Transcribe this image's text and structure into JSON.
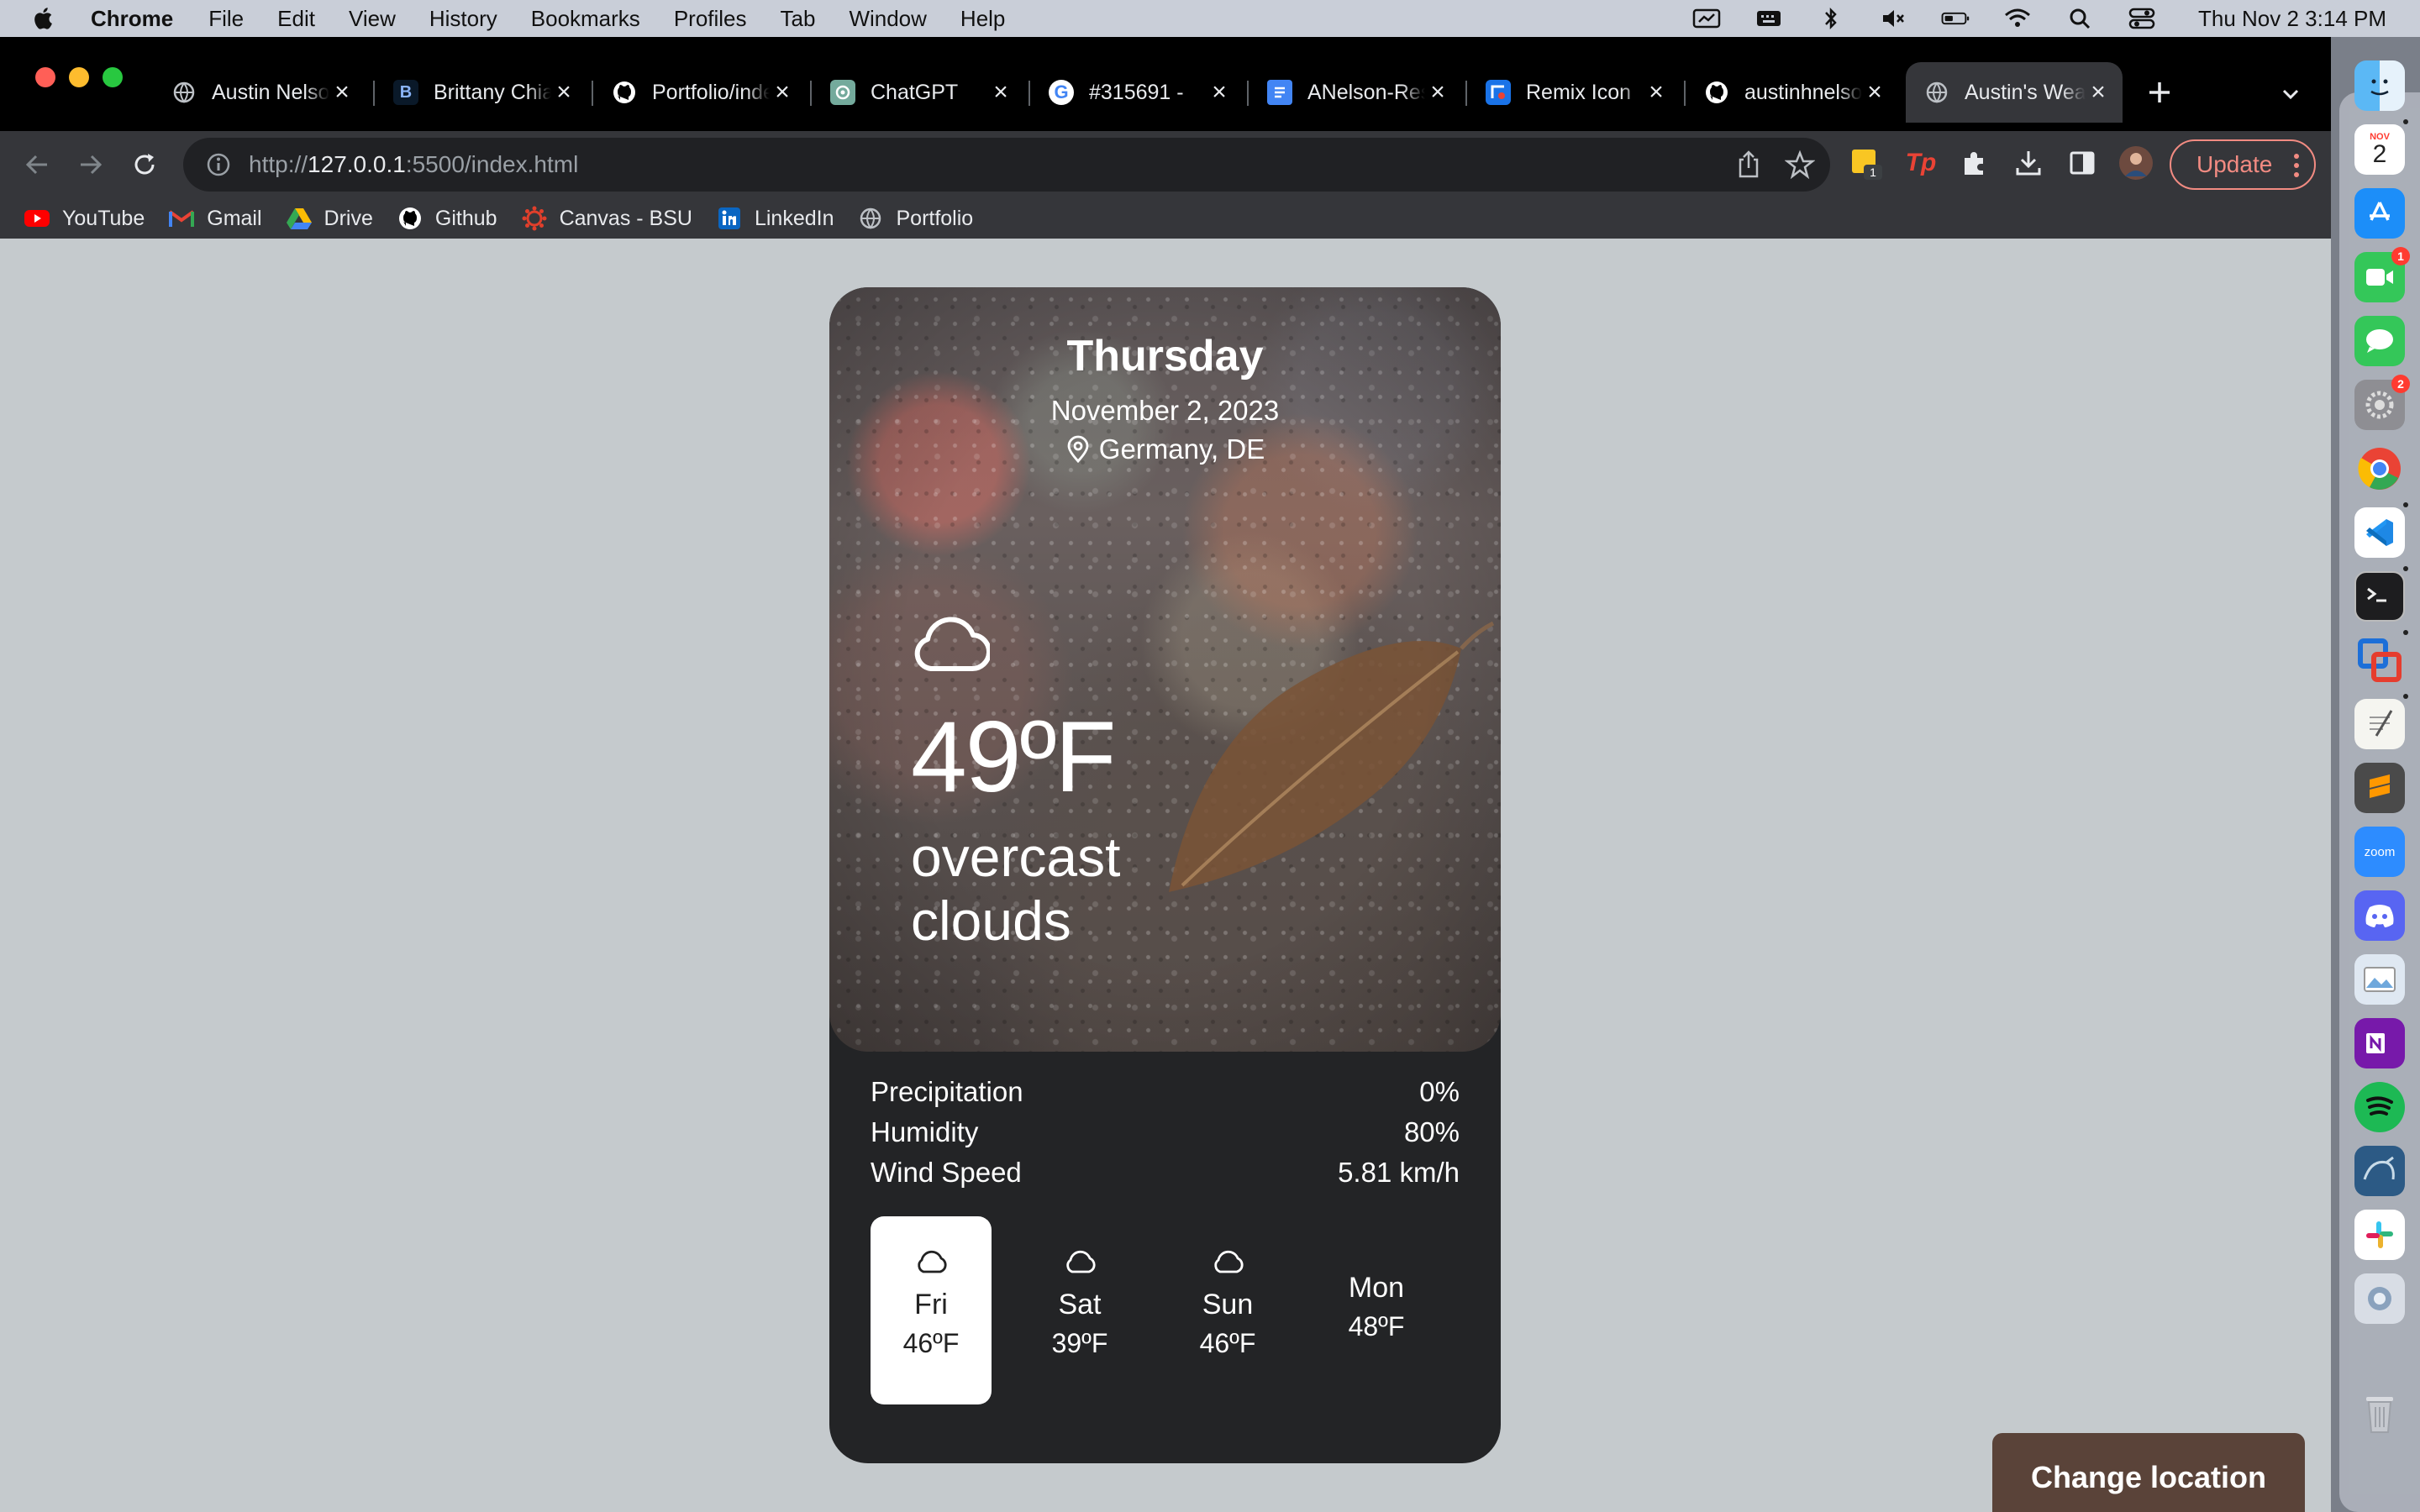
{
  "menubar": {
    "app_name": "Chrome",
    "menus": [
      "File",
      "Edit",
      "View",
      "History",
      "Bookmarks",
      "Profiles",
      "Tab",
      "Window",
      "Help"
    ],
    "clock": "Thu Nov 2  3:14 PM"
  },
  "browser": {
    "tabs": [
      {
        "label": "Austin Nelson",
        "icon": "globe-icon"
      },
      {
        "label": "Brittany Chiang",
        "icon": "b-logo-icon"
      },
      {
        "label": "Portfolio/index",
        "icon": "github-icon"
      },
      {
        "label": "ChatGPT",
        "icon": "chatgpt-icon"
      },
      {
        "label": "#315691 - ",
        "icon": "google-icon"
      },
      {
        "label": "ANelson-Resume",
        "icon": "docs-icon"
      },
      {
        "label": "Remix Icon",
        "icon": "remix-icon"
      },
      {
        "label": "austinhnelson",
        "icon": "github-icon"
      },
      {
        "label": "Austin's Weather",
        "icon": "globe-icon",
        "active": true
      }
    ],
    "url_prefix": "http://",
    "url_host": "127.0.0.1",
    "url_rest": ":5500/index.html",
    "update_label": "Update",
    "extension_badge": "1",
    "bookmarks": [
      {
        "label": "YouTube",
        "icon": "youtube-icon"
      },
      {
        "label": "Gmail",
        "icon": "gmail-icon"
      },
      {
        "label": "Drive",
        "icon": "drive-icon"
      },
      {
        "label": "Github",
        "icon": "github-icon"
      },
      {
        "label": "Canvas - BSU",
        "icon": "canvas-icon"
      },
      {
        "label": "LinkedIn",
        "icon": "linkedin-icon"
      },
      {
        "label": "Portfolio",
        "icon": "globe-icon"
      }
    ]
  },
  "weather": {
    "day": "Thursday",
    "date": "November 2, 2023",
    "location": "Germany, DE",
    "temperature": "49ºF",
    "description": "overcast clouds",
    "stats": [
      {
        "label": "Precipitation",
        "value": "0%"
      },
      {
        "label": "Humidity",
        "value": "80%"
      },
      {
        "label": "Wind Speed",
        "value": "5.81 km/h"
      }
    ],
    "forecast": [
      {
        "day": "Fri",
        "temp": "46ºF",
        "icon": "cloud-icon",
        "active": true
      },
      {
        "day": "Sat",
        "temp": "39ºF",
        "icon": "cloud-icon",
        "active": false
      },
      {
        "day": "Sun",
        "temp": "46ºF",
        "icon": "cloud-icon",
        "active": false
      },
      {
        "day": "Mon",
        "temp": "48ºF",
        "icon": "",
        "active": false
      }
    ],
    "change_location_label": "Change location",
    "colors": {
      "card": "#232426",
      "button": "#5a4339",
      "page_bg": "#c5cacd"
    }
  },
  "dock": {
    "calendar_month": "NOV",
    "calendar_day": "2",
    "facetime_badge": "1",
    "settings_badge": "2",
    "zoom_label": "zoom",
    "apps": [
      "finder-icon",
      "calendar-icon",
      "app-store-icon",
      "facetime-icon",
      "messages-icon",
      "system-settings-icon",
      "chrome-icon",
      "vscode-icon",
      "terminal-icon",
      "vmware-icon",
      "textedit-icon",
      "sublime-icon",
      "zoom-icon",
      "discord-icon",
      "preview-icon",
      "onenote-icon",
      "spotify-icon",
      "mysql-workbench-icon",
      "slack-icon",
      "utility-icon",
      "trash-icon"
    ]
  }
}
